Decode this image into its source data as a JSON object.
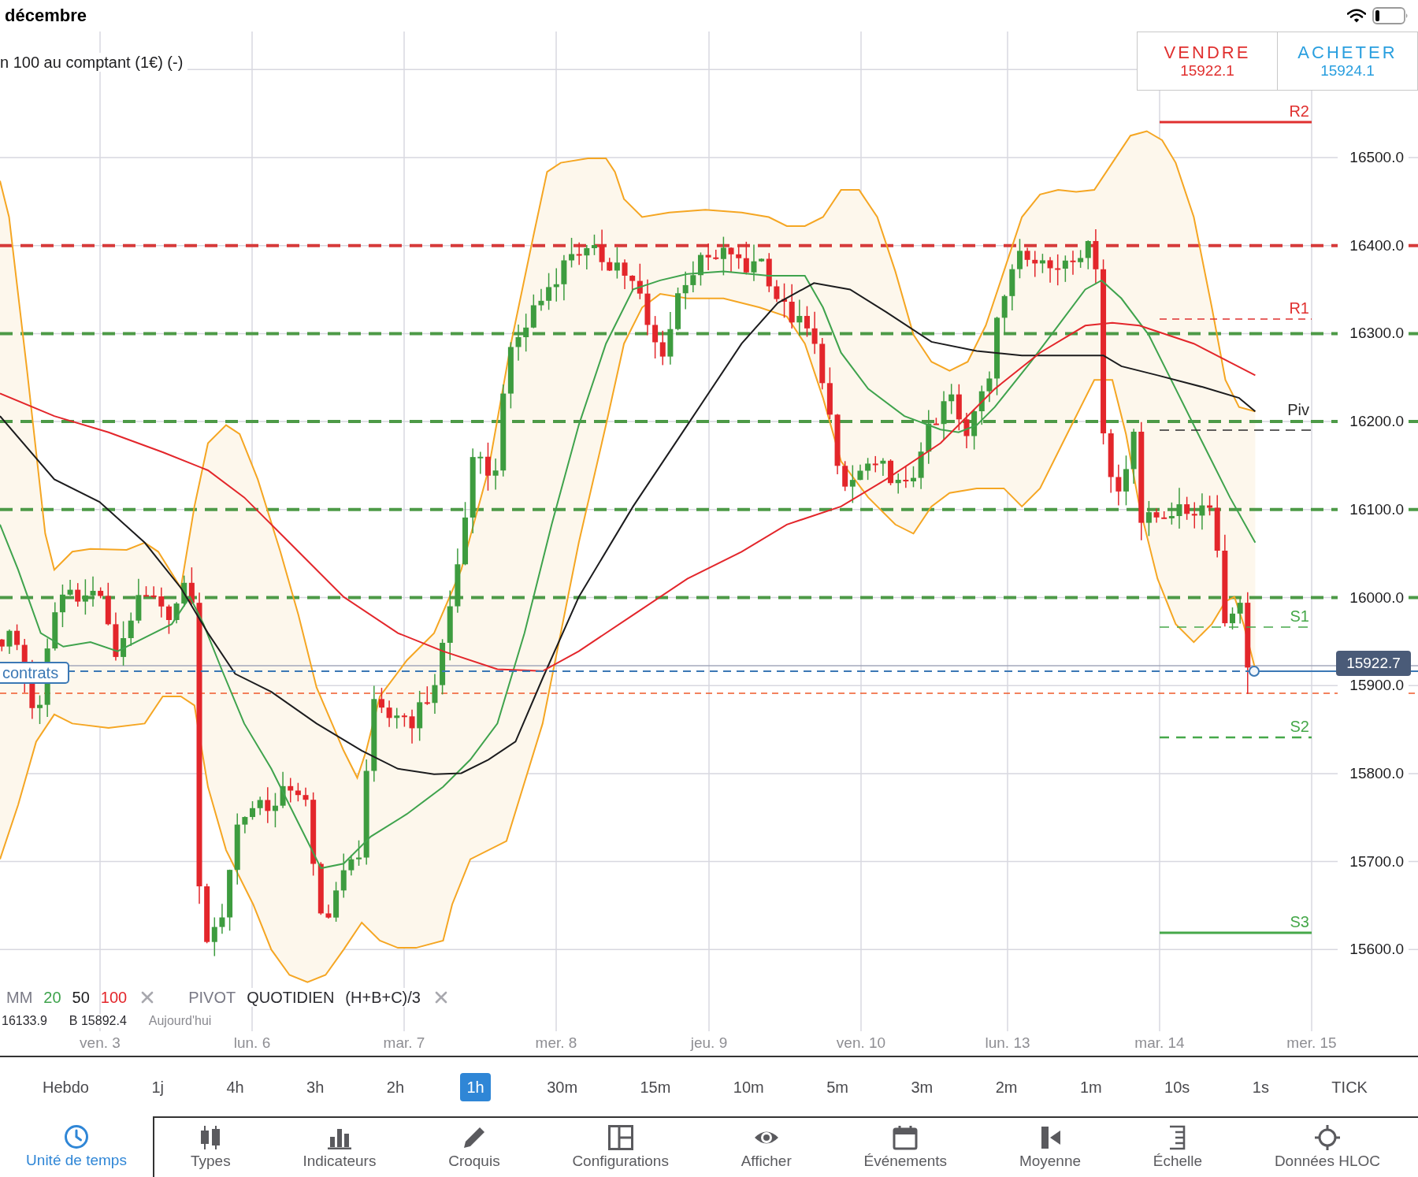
{
  "status_bar": {
    "month": "décembre"
  },
  "chart": {
    "title": "n 100 au comptant (1€) (-)",
    "trade_buttons": [
      {
        "kind": "sell",
        "label": "VENDRE",
        "price": "15922.1"
      },
      {
        "kind": "buy",
        "label": "ACHETER",
        "price": "15924.1"
      }
    ],
    "levels": [
      {
        "label": "R2",
        "kind": "resistance"
      },
      {
        "label": "R1",
        "kind": "resistance"
      },
      {
        "label": "Piv",
        "kind": "pivot"
      },
      {
        "label": "S1",
        "kind": "support"
      },
      {
        "label": "S2",
        "kind": "support"
      },
      {
        "label": "S3",
        "kind": "support"
      }
    ],
    "price_axis": [
      "16500.0",
      "16400.0",
      "16300.0",
      "16200.0",
      "16100.0",
      "16000.0",
      "15900.0",
      "15800.0",
      "15700.0",
      "15600.0"
    ],
    "current_price": "15922.7",
    "position_tag": "contrats",
    "indicators": [
      {
        "kind": "moving_average",
        "name": "MM",
        "periods": [
          {
            "label": "20",
            "color": "#3fa34d"
          },
          {
            "label": "50",
            "color": "#1c1c1e"
          },
          {
            "label": "100",
            "color": "#e3262b"
          }
        ]
      },
      {
        "kind": "pivot",
        "name": "PIVOT",
        "params": [
          "QUOTIDIEN",
          "(H+B+C)/3"
        ]
      }
    ],
    "indicator_values": [
      "16133.9",
      "B 15892.4",
      "Aujourd'hui"
    ],
    "date_axis": [
      "ven. 3",
      "lun. 6",
      "mar. 7",
      "mer. 8",
      "jeu. 9",
      "ven. 10",
      "lun. 13",
      "mar. 14",
      "mer. 15"
    ]
  },
  "timeframes": [
    {
      "label": "Hebdo",
      "selected": false
    },
    {
      "label": "1j",
      "selected": false
    },
    {
      "label": "4h",
      "selected": false
    },
    {
      "label": "3h",
      "selected": false
    },
    {
      "label": "2h",
      "selected": false
    },
    {
      "label": "1h",
      "selected": true
    },
    {
      "label": "30m",
      "selected": false
    },
    {
      "label": "15m",
      "selected": false
    },
    {
      "label": "10m",
      "selected": false
    },
    {
      "label": "5m",
      "selected": false
    },
    {
      "label": "3m",
      "selected": false
    },
    {
      "label": "2m",
      "selected": false
    },
    {
      "label": "1m",
      "selected": false
    },
    {
      "label": "10s",
      "selected": false
    },
    {
      "label": "1s",
      "selected": false
    },
    {
      "label": "TICK",
      "selected": false
    }
  ],
  "toolbar": [
    {
      "label": "Unité de temps",
      "selected": true
    },
    {
      "label": "Types",
      "selected": false
    },
    {
      "label": "Indicateurs",
      "selected": false
    },
    {
      "label": "Croquis",
      "selected": false
    },
    {
      "label": "Configurations",
      "selected": false
    },
    {
      "label": "Afficher",
      "selected": false
    },
    {
      "label": "Événements",
      "selected": false
    },
    {
      "label": "Moyenne",
      "selected": false
    },
    {
      "label": "Échelle",
      "selected": false
    },
    {
      "label": "Données HLOC",
      "selected": false
    }
  ]
}
